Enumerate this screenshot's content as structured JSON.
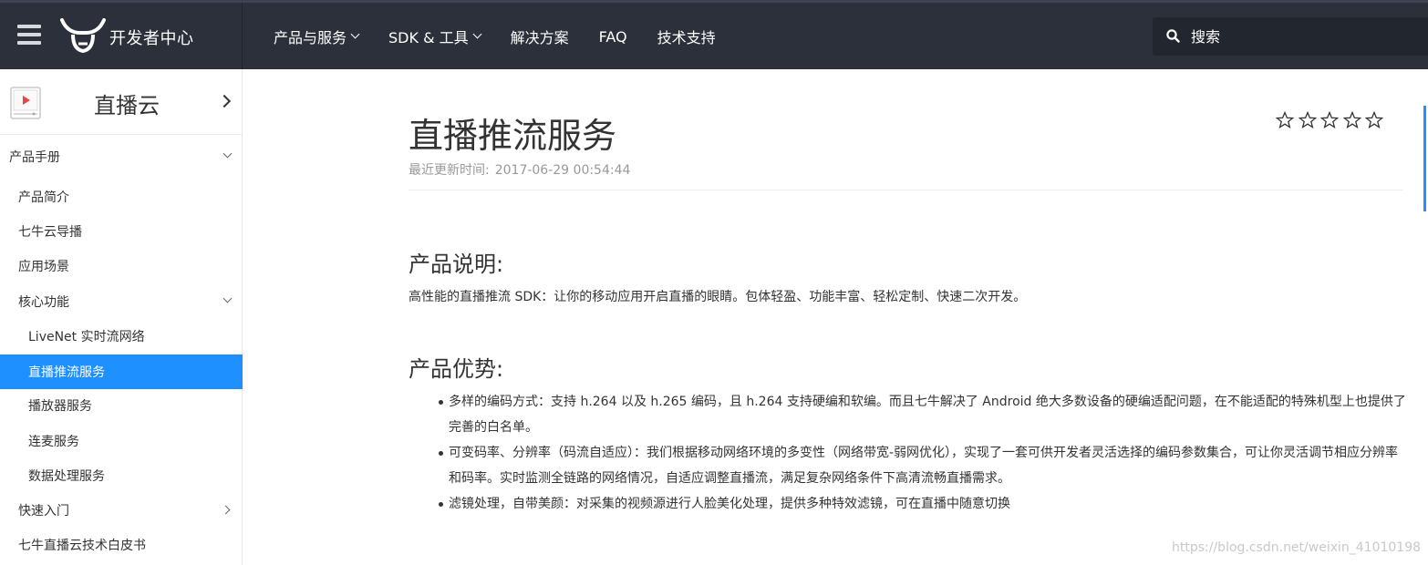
{
  "topbar": {
    "brand": "开发者中心",
    "nav": [
      {
        "label": "产品与服务",
        "has_dropdown": true
      },
      {
        "label": "SDK & 工具",
        "has_dropdown": true
      },
      {
        "label": "解决方案",
        "has_dropdown": false
      },
      {
        "label": "FAQ",
        "has_dropdown": false
      },
      {
        "label": "技术支持",
        "has_dropdown": false
      }
    ],
    "search_placeholder": "搜索"
  },
  "sidebar": {
    "product_title": "直播云",
    "items": [
      {
        "label": "产品手册",
        "level": 0,
        "chevron": "down"
      },
      {
        "label": "产品简介",
        "level": 1
      },
      {
        "label": "七牛云导播",
        "level": 1
      },
      {
        "label": "应用场景",
        "level": 1
      },
      {
        "label": "核心功能",
        "level": 1,
        "chevron": "down"
      },
      {
        "label": "LiveNet 实时流网络",
        "level": 2
      },
      {
        "label": "直播推流服务",
        "level": 2,
        "active": true
      },
      {
        "label": "播放器服务",
        "level": 2
      },
      {
        "label": "连麦服务",
        "level": 2
      },
      {
        "label": "数据处理服务",
        "level": 2
      },
      {
        "label": "快速入门",
        "level": 1,
        "chevron": "right"
      },
      {
        "label": "七牛直播云技术白皮书",
        "level": 1
      }
    ]
  },
  "main": {
    "title": "直播推流服务",
    "updated_label": "最近更新时间:",
    "updated_value": "2017-06-29 00:54:44",
    "rating_stars": 5,
    "sections": [
      {
        "heading": "产品说明:",
        "text": "高性能的直播推流 SDK：让你的移动应用开启直播的眼睛。包体轻盈、功能丰富、轻松定制、快速二次开发。"
      },
      {
        "heading": "产品优势:",
        "bullets": [
          "多样的编码方式：支持 h.264 以及 h.265 编码，且 h.264 支持硬编和软编。而且七牛解决了 Android 绝大多数设备的硬编适配问题，在不能适配的特殊机型上也提供了完善的白名单。",
          "可变码率、分辨率（码流自适应）：我们根据移动网络环境的多变性（网络带宽-弱网优化），实现了一套可供开发者灵活选择的编码参数集合，可让你灵活调节相应分辨率和码率。实时监测全链路的网络情况，自适应调整直播流，满足复杂网络条件下高清流畅直播需求。",
          "滤镜处理，自带美颜：对采集的视频源进行人脸美化处理，提供多种特效滤镜，可在直播中随意切换"
        ]
      }
    ]
  },
  "watermark": "https://blog.csdn.net/weixin_41010198",
  "colors": {
    "topbar_bg": "#2b303b",
    "accent": "#1e90ff",
    "text": "#333333",
    "muted": "#999999"
  }
}
